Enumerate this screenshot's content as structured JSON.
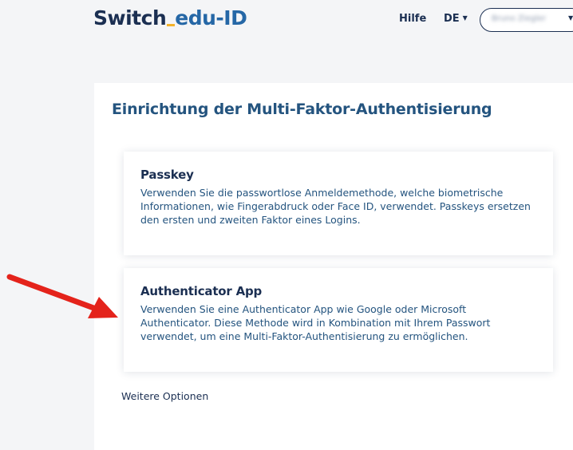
{
  "header": {
    "logo_brand": "Switch",
    "logo_product": "edu-ID",
    "help_label": "Hilfe",
    "language_label": "DE",
    "user_name": "Bruno Ziegler"
  },
  "main": {
    "title": "Einrichtung der Multi-Faktor-Authentisierung",
    "options": [
      {
        "title": "Passkey",
        "description": "Verwenden Sie die passwortlose Anmeldemethode, welche biometrische Informationen, wie Fingerabdruck oder Face ID, verwendet. Passkeys ersetzen den ersten und zweiten Faktor eines Logins."
      },
      {
        "title": "Authenticator App",
        "description": "Verwenden Sie eine Authenticator App wie Google oder Microsoft Authenticator. Diese Methode wird in Kombination mit Ihrem Passwort verwendet, um eine Multi-Faktor-Authentisierung zu ermöglichen."
      }
    ],
    "more_options_label": "Weitere Optionen"
  },
  "colors": {
    "brand_navy": "#1b2f52",
    "brand_blue": "#2567a6",
    "accent_yellow": "#f3b32b",
    "annotation_red": "#e4231b"
  },
  "icons": {
    "language_caret": "chevron-down-icon",
    "user_caret": "chevron-down-icon",
    "annotation": "red-arrow-icon"
  }
}
